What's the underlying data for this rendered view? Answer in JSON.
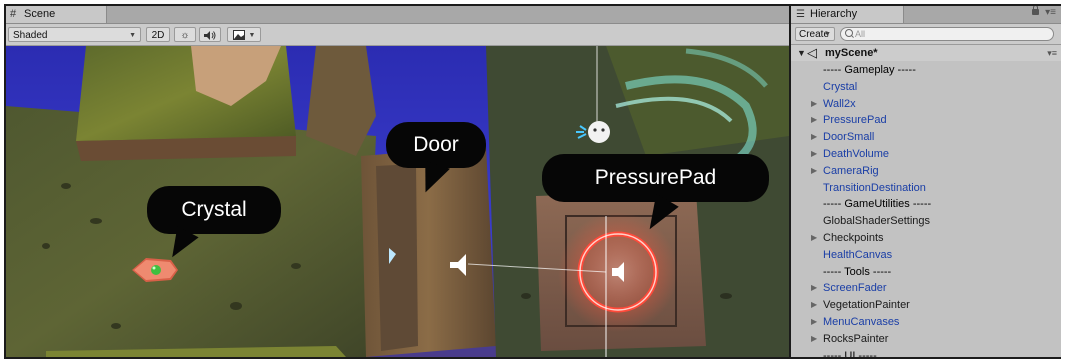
{
  "scene_panel": {
    "tab_label": "Scene",
    "tab_icon": "hash-icon",
    "toolbar": {
      "shading_mode": "Shaded",
      "toggle_2d": "2D",
      "lighting_icon": "sun-icon",
      "audio_icon": "speaker-icon",
      "effects_icon": "image-icon"
    },
    "callouts": {
      "door": "Door",
      "crystal": "Crystal",
      "pressure_pad": "PressurePad"
    }
  },
  "hierarchy_panel": {
    "tab_label": "Hierarchy",
    "tab_icon": "list-icon",
    "create_label": "Create",
    "search_placeholder": "All",
    "scene_name": "myScene*",
    "items": [
      {
        "label": "----- Gameplay -----",
        "kind": "separator",
        "expandable": false
      },
      {
        "label": "Crystal",
        "kind": "prefab",
        "expandable": false
      },
      {
        "label": "Wall2x",
        "kind": "prefab",
        "expandable": true
      },
      {
        "label": "PressurePad",
        "kind": "prefab",
        "expandable": true
      },
      {
        "label": "DoorSmall",
        "kind": "prefab",
        "expandable": true
      },
      {
        "label": "DeathVolume",
        "kind": "prefab",
        "expandable": true
      },
      {
        "label": "CameraRig",
        "kind": "prefab",
        "expandable": true
      },
      {
        "label": "TransitionDestination",
        "kind": "prefab",
        "expandable": false
      },
      {
        "label": "----- GameUtilities -----",
        "kind": "separator",
        "expandable": false
      },
      {
        "label": "GlobalShaderSettings",
        "kind": "plain",
        "expandable": false
      },
      {
        "label": "Checkpoints",
        "kind": "plain",
        "expandable": true
      },
      {
        "label": "HealthCanvas",
        "kind": "prefab",
        "expandable": false
      },
      {
        "label": "----- Tools -----",
        "kind": "separator",
        "expandable": false
      },
      {
        "label": "ScreenFader",
        "kind": "prefab",
        "expandable": true
      },
      {
        "label": "VegetationPainter",
        "kind": "plain",
        "expandable": true
      },
      {
        "label": "MenuCanvases",
        "kind": "prefab",
        "expandable": true
      },
      {
        "label": "RocksPainter",
        "kind": "plain",
        "expandable": true
      },
      {
        "label": "----- UI -----",
        "kind": "separator",
        "expandable": false
      }
    ]
  },
  "colors": {
    "prefab_text": "#1a3ea6",
    "plain_text": "#1a1a1a",
    "callout_bg": "#060606",
    "editor_chrome": "#c2c2c2"
  }
}
